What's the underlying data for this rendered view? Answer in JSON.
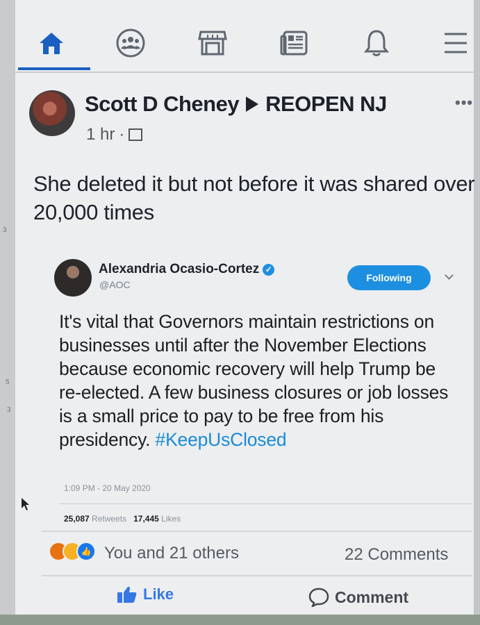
{
  "nav": {
    "items": [
      "home-icon",
      "groups-icon",
      "marketplace-icon",
      "news-feed-icon",
      "notifications-icon",
      "menu-icon"
    ],
    "active": "home-icon",
    "accent": "#1b5fc1"
  },
  "post": {
    "author": "Scott D Cheney",
    "group": "REOPEN NJ",
    "time": "1 hr",
    "text": "She deleted it but not before it was shared over 20,000 times"
  },
  "tweet": {
    "name": "Alexandria Ocasio-Cortez",
    "handle": "@AOC",
    "follow_label": "Following",
    "text": "It's vital that Governors maintain restrictions on businesses until after the November Elections because economic recovery will help Trump be re-elected. A few business closures or job losses is a small price to pay to be free from his presidency.",
    "hashtag": "#KeepUsClosed",
    "timestamp": "1:09 PM - 20 May 2020",
    "retweets_count": "25,087",
    "retweets_label": "Retweets",
    "likes_count": "17,445",
    "likes_label": "Likes",
    "link_color": "#1b8ad6"
  },
  "reactions": {
    "text": "You and 21 others",
    "comments": "22 Comments"
  },
  "actions": {
    "like_label": "Like",
    "comment_label": "Comment"
  },
  "margin_numbers": [
    "3",
    "5",
    "3"
  ]
}
